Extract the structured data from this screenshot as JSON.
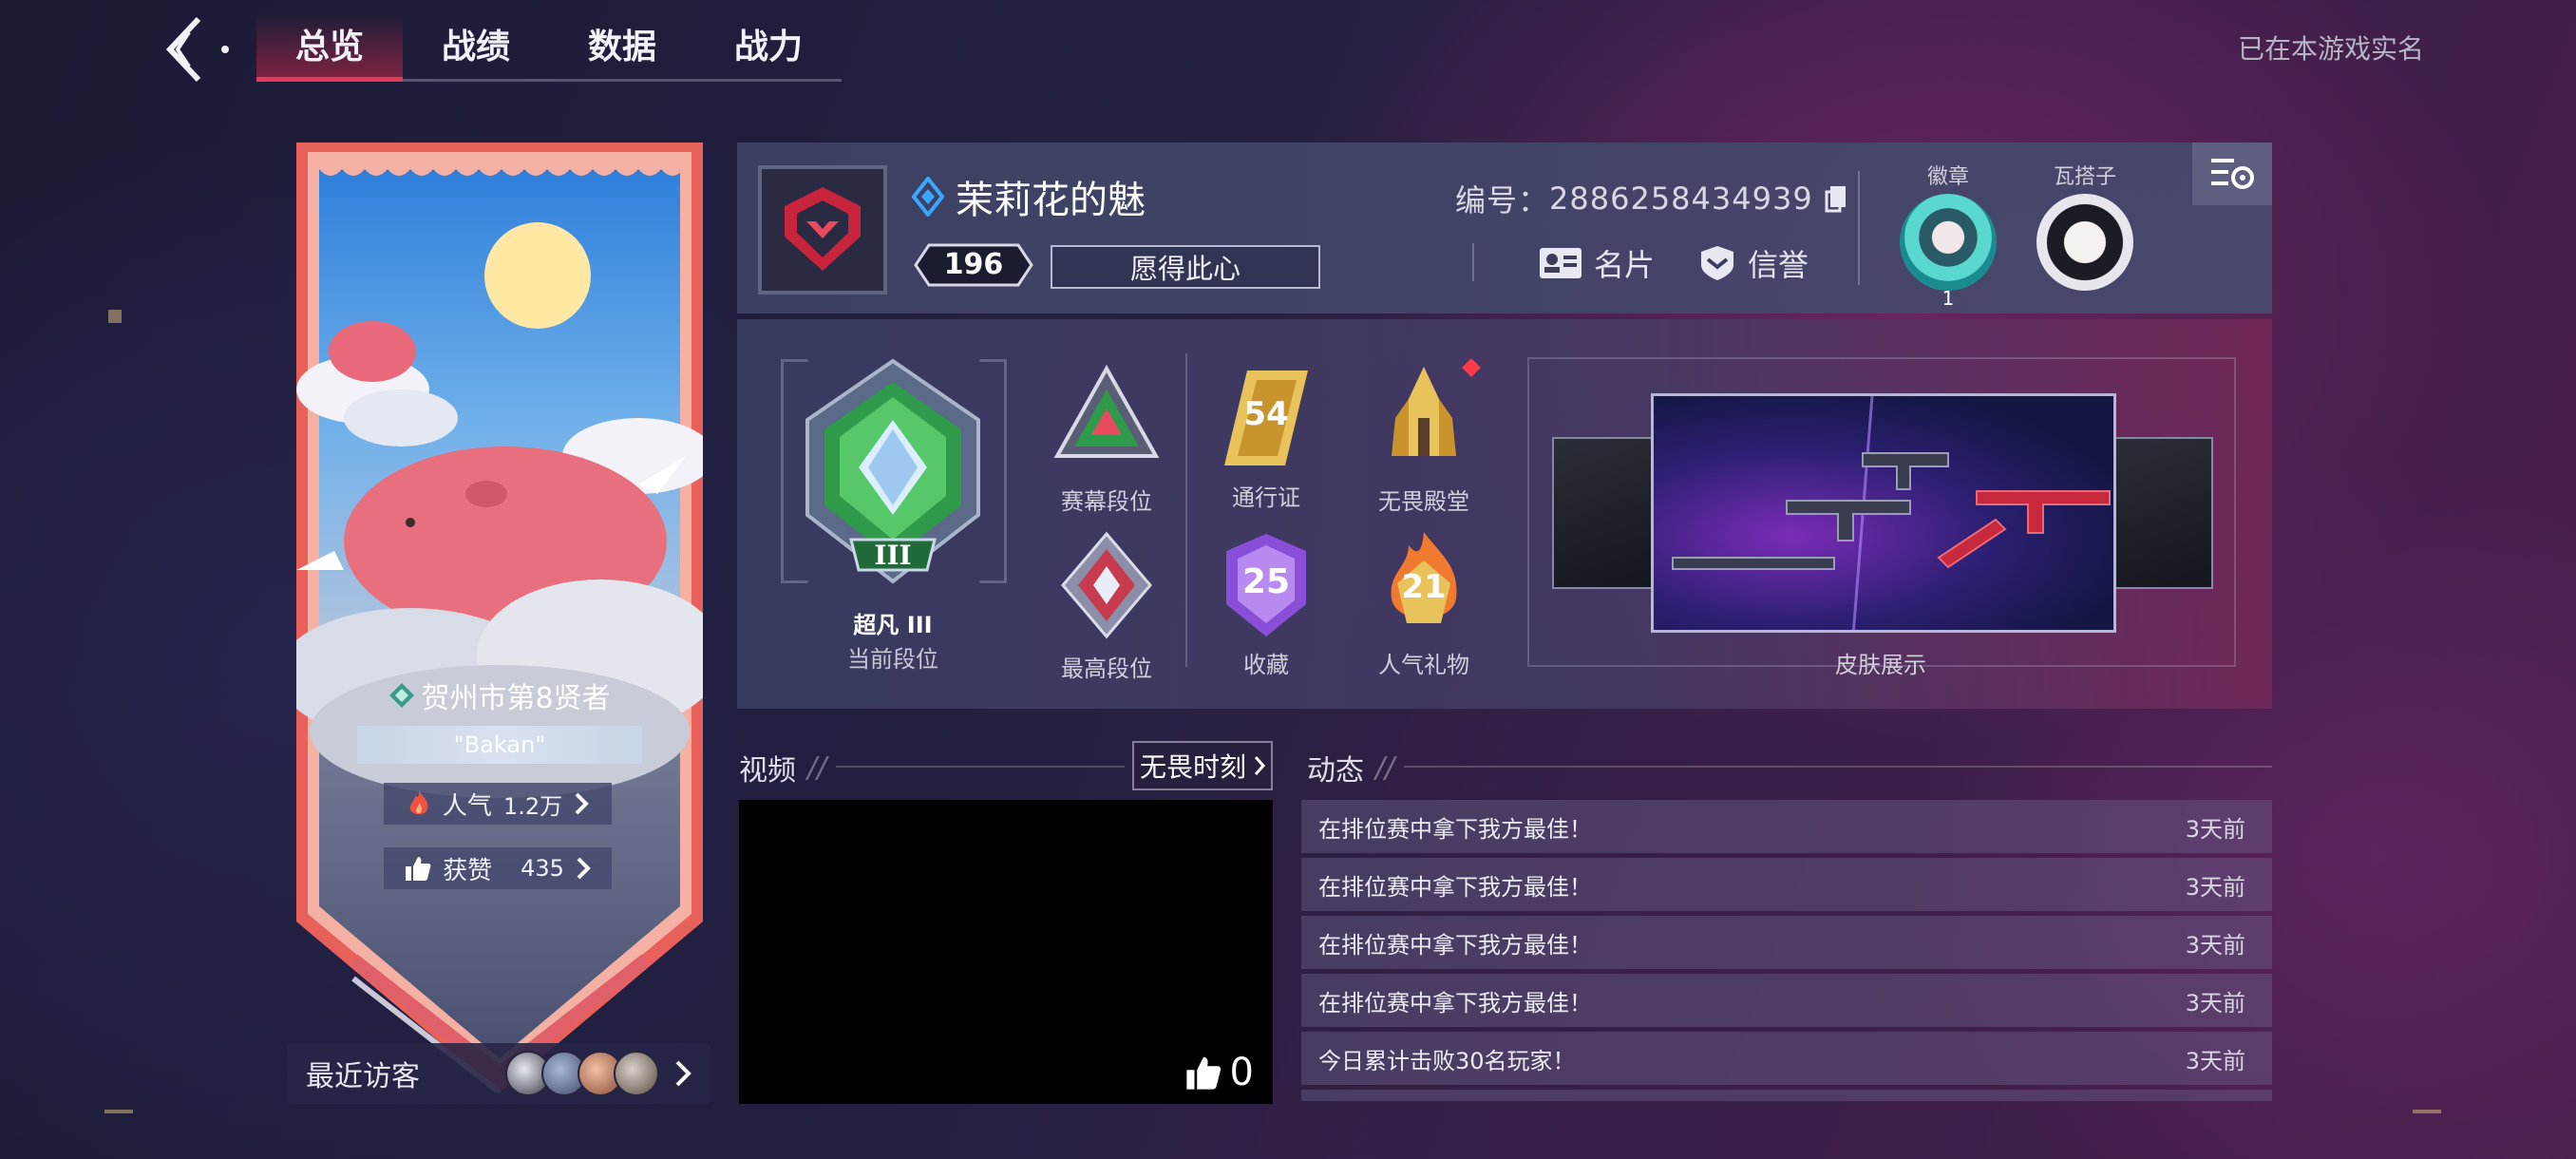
{
  "nav": {
    "tabs": [
      {
        "label": "总览",
        "active": true
      },
      {
        "label": "战绩"
      },
      {
        "label": "数据"
      },
      {
        "label": "战力"
      }
    ],
    "realname_notice": "已在本游戏实名"
  },
  "banner": {
    "title": "贺州市第8贤者",
    "nickname_tag": "\"Bakan\"",
    "popularity_label": "人气",
    "popularity_value": "1.2万",
    "likes_label": "获赞",
    "likes_value": "435",
    "visitors_label": "最近访客"
  },
  "profile": {
    "name": "茉莉花的魅",
    "level": "196",
    "motto": "愿得此心",
    "uid_label": "编号：",
    "uid_value": "2886258434939",
    "card_label": "名片",
    "credit_label": "信誉",
    "badge_label": "徽章",
    "badge_count": "1",
    "agent_label": "瓦搭子"
  },
  "stats": {
    "current_rank_name": "超凡 III",
    "current_rank_label": "当前段位",
    "items": [
      {
        "label": "赛幕段位"
      },
      {
        "label": "通行证",
        "value": "54"
      },
      {
        "label": "无畏殿堂"
      },
      {
        "label": "最高段位"
      },
      {
        "label": "收藏",
        "value": "25"
      },
      {
        "label": "人气礼物",
        "value": "21"
      }
    ],
    "skin_label": "皮肤展示"
  },
  "video": {
    "title": "视频",
    "moment_button": "无畏时刻",
    "likes": "0"
  },
  "feed": {
    "title": "动态",
    "items": [
      {
        "text": "在排位赛中拿下我方最佳！",
        "time": "3天前"
      },
      {
        "text": "在排位赛中拿下我方最佳！",
        "time": "3天前"
      },
      {
        "text": "在排位赛中拿下我方最佳！",
        "time": "3天前"
      },
      {
        "text": "在排位赛中拿下我方最佳！",
        "time": "3天前"
      },
      {
        "text": "今日累计击败30名玩家！",
        "time": "3天前"
      }
    ]
  },
  "colors": {
    "accent_red": "#e53a55",
    "rank_green": "#3fae5a",
    "gold": "#e8c25a",
    "purple": "#8a4fd8"
  }
}
